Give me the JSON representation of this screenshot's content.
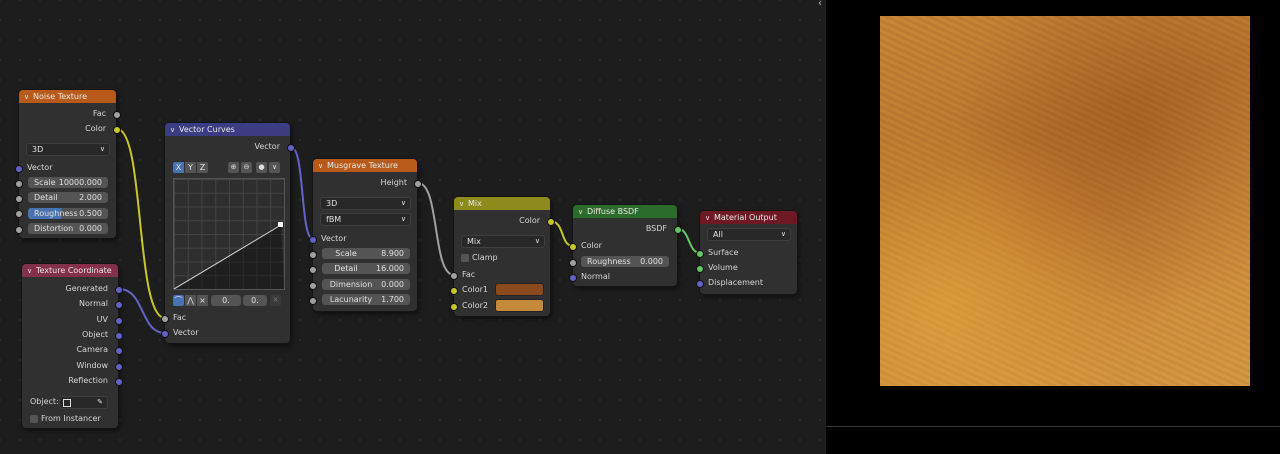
{
  "nodes": {
    "noise_texture": {
      "title": "Noise Texture",
      "outputs": [
        "Fac",
        "Color"
      ],
      "dimension": "3D",
      "vector_label": "Vector",
      "fields": [
        {
          "label": "Scale",
          "value": "10000.000"
        },
        {
          "label": "Detail",
          "value": "2.000"
        },
        {
          "label": "Roughness",
          "value": "0.500"
        },
        {
          "label": "Distortion",
          "value": "0.000"
        }
      ],
      "roughness_fill": 0.5
    },
    "texture_coordinate": {
      "title": "Texture Coordinate",
      "outputs": [
        "Generated",
        "Normal",
        "UV",
        "Object",
        "Camera",
        "Window",
        "Reflection"
      ],
      "object_label": "Object:",
      "from_instancer_label": "From Instancer"
    },
    "vector_curves": {
      "title": "Vector Curves",
      "output": "Vector",
      "tabs": [
        "X",
        "Y",
        "Z"
      ],
      "zoom_in_icon": "zoom-in-icon",
      "zoom_out_icon": "zoom-out-icon",
      "handle_values": [
        "0.",
        "0."
      ],
      "inputs": [
        "Fac",
        "Vector"
      ]
    },
    "musgrave_texture": {
      "title": "Musgrave Texture",
      "output": "Height",
      "dimension": "3D",
      "type": "fBM",
      "vector_label": "Vector",
      "fields": [
        {
          "label": "Scale",
          "value": "8.900"
        },
        {
          "label": "Detail",
          "value": "16.000"
        },
        {
          "label": "Dimension",
          "value": "0.000"
        },
        {
          "label": "Lacunarity",
          "value": "1.700"
        }
      ]
    },
    "mix": {
      "title": "Mix",
      "output": "Color",
      "blend_mode": "Mix",
      "clamp_label": "Clamp",
      "inputs": [
        "Fac",
        "Color1",
        "Color2"
      ],
      "color1": "#8a4a1e",
      "color2": "#c48a3a"
    },
    "diffuse_bsdf": {
      "title": "Diffuse BSDF",
      "output": "BSDF",
      "inputs": [
        "Color",
        "Normal"
      ],
      "roughness": {
        "label": "Roughness",
        "value": "0.000"
      }
    },
    "material_output": {
      "title": "Material Output",
      "target": "All",
      "inputs": [
        "Surface",
        "Volume",
        "Displacement"
      ]
    }
  },
  "colors": {
    "texture_header": "#b85a1a",
    "vector_header": "#3c3c83",
    "input_header": "#83314a",
    "color_header": "#8c8c1a",
    "shader_header": "#2b6b2b",
    "output_header": "#6e1a25",
    "accent": "#4772b3",
    "render_surface": "#c48636"
  },
  "preview": {
    "expand_icon": "expand-arrows-icon",
    "expand_glyph": "‹ ›"
  }
}
